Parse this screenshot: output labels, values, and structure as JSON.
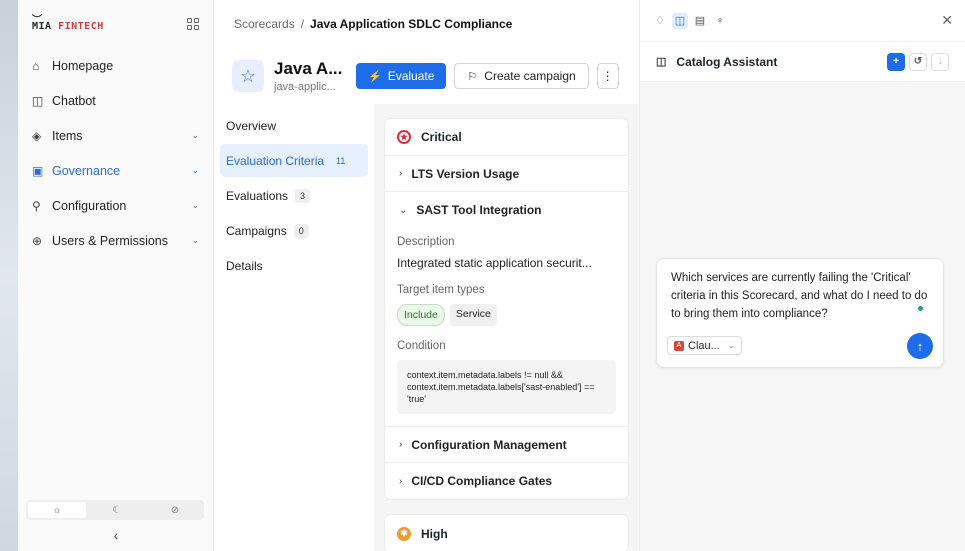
{
  "sidebar": {
    "logo_main": "MIA ",
    "logo_accent": "FINTECH",
    "items": [
      {
        "label": "Homepage",
        "icon": "⌂"
      },
      {
        "label": "Chatbot",
        "icon": "◫"
      },
      {
        "label": "Items",
        "icon": "◈",
        "chev": "⌄"
      },
      {
        "label": "Governance",
        "icon": "▣",
        "chev": "⌄",
        "active": true
      },
      {
        "label": "Configuration",
        "icon": "⚲",
        "chev": "⌄"
      },
      {
        "label": "Users & Permissions",
        "icon": "⊕",
        "chev": "⌄"
      }
    ],
    "theme": {
      "light": "☼",
      "dark": "☾",
      "system": "⊘"
    },
    "collapse": "‹"
  },
  "breadcrumb": {
    "parent": "Scorecards",
    "sep": "/",
    "current": "Java Application SDLC Compliance"
  },
  "header": {
    "title": "Java A...",
    "subtitle": "java-applic...",
    "evaluate_label": "Evaluate",
    "campaign_label": "Create campaign",
    "more": "⋮"
  },
  "subnav": [
    {
      "label": "Overview",
      "count": ""
    },
    {
      "label": "Evaluation Criteria",
      "count": "11"
    },
    {
      "label": "Evaluations",
      "count": "3"
    },
    {
      "label": "Campaigns",
      "count": "0"
    },
    {
      "label": "Details",
      "count": ""
    }
  ],
  "criteria": {
    "critical_label": "Critical",
    "rows": [
      "LTS Version Usage",
      "SAST Tool Integration",
      "Configuration Management",
      "CI/CD Compliance Gates"
    ],
    "detail": {
      "desc_label": "Description",
      "desc_value": "Integrated static application securit...",
      "types_label": "Target item types",
      "include_tag": "Include",
      "type_tag": "Service",
      "cond_label": "Condition",
      "cond_value": "context.item.metadata.labels != null && context.item.metadata.labels['sast-enabled'] == 'true'"
    },
    "high_label": "High"
  },
  "panel": {
    "close": "✕",
    "assistant_title": "Catalog Assistant",
    "prompt": "Which services are currently failing the 'Critical' criteria in this Scorecard, and what do I need to do to bring them into compliance?",
    "model": "Clau...",
    "send": "↑"
  }
}
